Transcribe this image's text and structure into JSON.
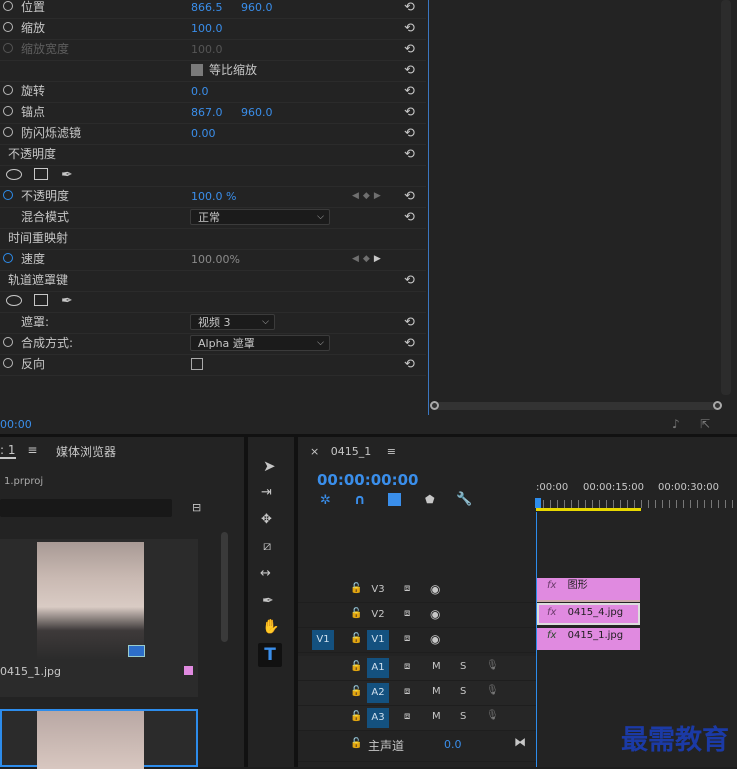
{
  "effects": {
    "rows": [
      {
        "label": "位置",
        "v1": "866.5",
        "v2": "960.0"
      },
      {
        "label": "缩放",
        "v1": "100.0"
      },
      {
        "label": "缩放宽度",
        "v1": "100.0"
      },
      {
        "label": "等比缩放"
      },
      {
        "label": "旋转",
        "v1": "0.0"
      },
      {
        "label": "锚点",
        "v1": "867.0",
        "v2": "960.0"
      },
      {
        "label": "防闪烁滤镜",
        "v1": "0.00"
      }
    ],
    "opacity_section": "不透明度",
    "opacity": {
      "label": "不透明度",
      "value": "100.0 %"
    },
    "blend": {
      "label": "混合模式",
      "value": "正常"
    },
    "time_remap": "时间重映射",
    "speed": {
      "label": "速度",
      "value": "100.00%"
    },
    "track_matte": "轨道遮罩键",
    "matte": {
      "label": "遮罩:",
      "value": "视频 3"
    },
    "composite": {
      "label": "合成方式:",
      "value": "Alpha 遮罩"
    },
    "reverse": {
      "label": "反向"
    },
    "timecode": "00:00"
  },
  "project": {
    "tab1": ": 1",
    "tab2": "媒体浏览器",
    "file": "1.prproj",
    "clip_name": "0415_1.jpg"
  },
  "sequence": {
    "tab": "0415_1",
    "timecode": "00:00:00:00",
    "ruler": [
      ":00:00",
      "00:00:15:00",
      "00:00:30:00"
    ],
    "video_tracks": [
      {
        "name": "V3",
        "clip": "图形",
        "fx": "fx"
      },
      {
        "name": "V2",
        "clip": "0415_4.jpg",
        "fx": "fx"
      },
      {
        "name": "V1",
        "clip": "0415_1.jpg",
        "fx": "fx",
        "source": "V1"
      }
    ],
    "audio_tracks": [
      {
        "name": "A1",
        "m": "M",
        "s": "S"
      },
      {
        "name": "A2",
        "m": "M",
        "s": "S"
      },
      {
        "name": "A3",
        "m": "M",
        "s": "S"
      }
    ],
    "master": {
      "label": "主声道",
      "value": "0.0"
    }
  },
  "watermark": "最需教育",
  "colors": {
    "accent": "#2d8ceb",
    "clip": "#e08ae0",
    "track_on": "#14517f"
  }
}
